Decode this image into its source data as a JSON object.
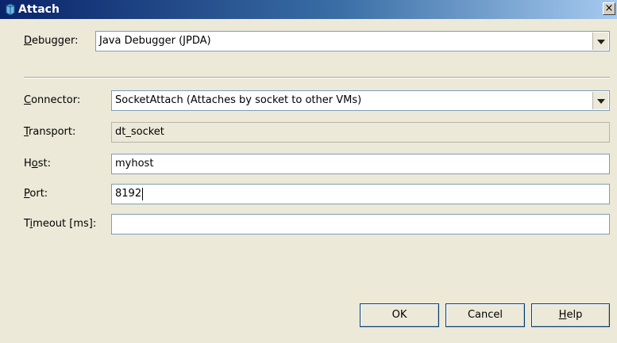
{
  "window": {
    "title": "Attach",
    "close_glyph": "×"
  },
  "form": {
    "debugger": {
      "label_mnemonic": "D",
      "label_rest": "ebugger:",
      "value": "Java Debugger (JPDA)"
    },
    "connector": {
      "label_mnemonic": "C",
      "label_rest": "onnector:",
      "value": "SocketAttach (Attaches by socket to other VMs)"
    },
    "transport": {
      "label_mnemonic": "T",
      "label_rest": "ransport:",
      "value": "dt_socket"
    },
    "host": {
      "label_pre": "H",
      "label_mnemonic": "o",
      "label_rest": "st:",
      "value": "myhost"
    },
    "port": {
      "label_mnemonic": "P",
      "label_rest": "ort:",
      "value": "8192"
    },
    "timeout": {
      "label_pre": "T",
      "label_mnemonic": "i",
      "label_rest": "meout [ms]:",
      "value": ""
    }
  },
  "buttons": {
    "ok": "OK",
    "cancel": "Cancel",
    "help_mnemonic": "H",
    "help_rest": "elp"
  },
  "icons": {
    "title": "java-cup-icon",
    "combo": "chevron-down-icon"
  }
}
